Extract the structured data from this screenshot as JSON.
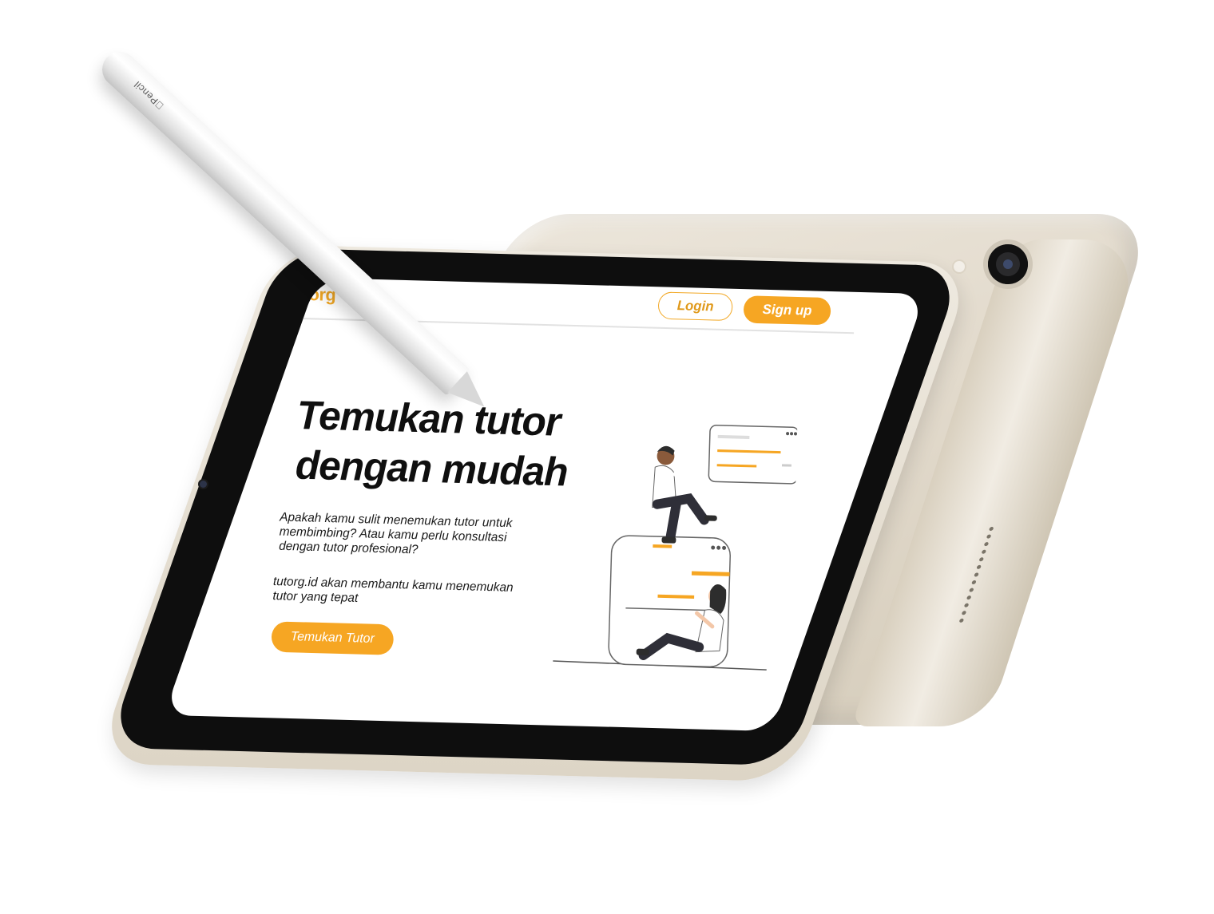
{
  "site": {
    "logo_text": "tutorg.id",
    "logo_prefix": "tut",
    "logo_accent": "org",
    "accent_color": "#f6a623"
  },
  "nav": {
    "login_label": "Login",
    "signup_label": "Sign up"
  },
  "hero": {
    "title_line1": "Temukan tutor",
    "title_line2": "dengan mudah",
    "description": "Apakah kamu sulit menemukan tutor untuk membimbing? Atau kamu perlu konsultasi dengan tutor profesional?",
    "description2": "tutorg.id akan membantu kamu menemukan tutor yang tepat",
    "cta_label": "Temukan Tutor"
  },
  "device": {
    "pencil_brand": "Pencil",
    "pencil_icon": "apple-logo-icon"
  }
}
